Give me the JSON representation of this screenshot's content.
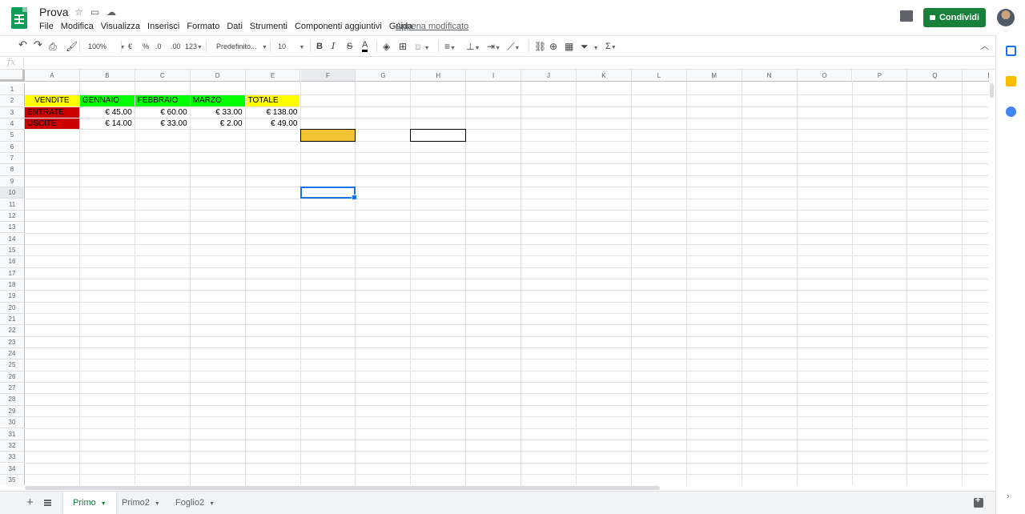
{
  "header": {
    "doc_title": "Prova",
    "menu": [
      "File",
      "Modifica",
      "Visualizza",
      "Inserisci",
      "Formato",
      "Dati",
      "Strumenti",
      "Componenti aggiuntivi",
      "Guida"
    ],
    "last_edit": "Appena modificato",
    "share_label": "Condividi"
  },
  "toolbar": {
    "zoom": "100%",
    "currency": "€",
    "percent": "%",
    "dec_less": ".0",
    "dec_more": ".00",
    "format_more": "123",
    "font": "Predefinito...",
    "font_size": "10",
    "bold": "B",
    "italic": "I",
    "strike": "S",
    "text_color": "A",
    "sum": "Σ"
  },
  "formula": {
    "fx": "fx",
    "value": ""
  },
  "grid": {
    "columns": [
      "A",
      "B",
      "C",
      "D",
      "E",
      "F",
      "G",
      "H",
      "I",
      "J",
      "K",
      "L",
      "M",
      "N",
      "O",
      "P",
      "Q",
      "R"
    ],
    "rows": [
      "1",
      "2",
      "3",
      "4",
      "5",
      "6",
      "7",
      "8",
      "9",
      "10",
      "11",
      "12",
      "13",
      "14",
      "15",
      "16",
      "17",
      "18",
      "19",
      "20",
      "21",
      "22",
      "23",
      "24",
      "25",
      "26",
      "27",
      "28",
      "29",
      "30",
      "31",
      "32",
      "33",
      "34",
      "35"
    ],
    "cells": {
      "A2": "VENDITE",
      "B2": "GENNAIO",
      "C2": "FEBBRAIO",
      "D2": "MARZO",
      "E2": "TOTALE",
      "A3": "ENTRATE",
      "B3": "€ 45.00",
      "C3": "€ 60.00",
      "D3": "€ 33.00",
      "E3": "€ 138.00",
      "A4": "USCITE",
      "B4": "€ 14.00",
      "C4": "€ 33.00",
      "D4": "€ 2.00",
      "E4": "€ 49.00"
    },
    "colors": {
      "yellow": "#ffff00",
      "green": "#00ff00",
      "red": "#cc0000",
      "orange": "#f1c232",
      "selection": "#1a73e8"
    }
  },
  "sheets": {
    "tabs": [
      "Primo",
      "Primo2",
      "Foglio2"
    ],
    "active": "Primo"
  }
}
